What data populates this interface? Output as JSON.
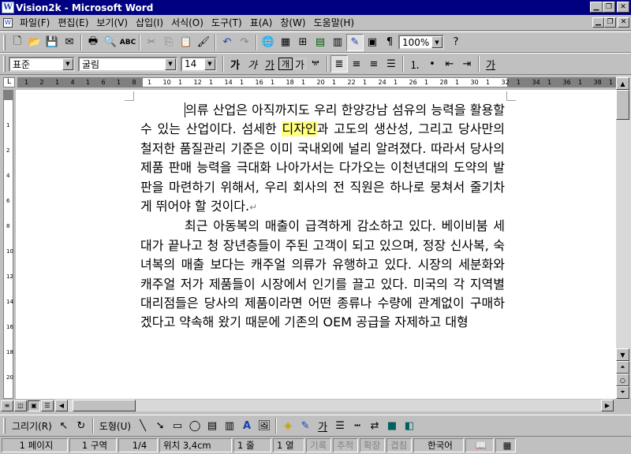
{
  "window": {
    "title": "Vision2k - Microsoft Word"
  },
  "menu": {
    "items": [
      "파일(F)",
      "편집(E)",
      "보기(V)",
      "삽입(I)",
      "서식(O)",
      "도구(T)",
      "표(A)",
      "창(W)",
      "도움말(H)"
    ]
  },
  "standard_toolbar": {
    "zoom": "100%"
  },
  "format_toolbar": {
    "style": "표준",
    "font": "굴림",
    "size": "14",
    "bold_glyph": "가",
    "italic_glyph": "가",
    "underline_glyph": "가",
    "border_glyph": "개",
    "shade_glyph": "가",
    "fontcolor_glyph": "가"
  },
  "ruler": {
    "labels": [
      "1",
      "2",
      "1",
      "4",
      "1",
      "6",
      "1",
      "8",
      "1",
      "10",
      "1",
      "12",
      "1",
      "14",
      "1",
      "16",
      "1",
      "18",
      "1",
      "20",
      "1",
      "22",
      "1",
      "24",
      "1",
      "26",
      "1",
      "28",
      "1",
      "30",
      "1",
      "32",
      "1",
      "34",
      "1",
      "36",
      "1",
      "38",
      "1",
      "40"
    ]
  },
  "document": {
    "p1_before": "의류 산업은 아직까지도 우리 한양강남 섬유의 능력을 활용할 수 있는 산업이다. 섬세한 ",
    "p1_highlight": "디자인",
    "p1_after": "과 고도의 생산성, 그리고 당사만의 철저한 품질관리 기준은 이미 국내외에 널리 알려졌다. 따라서 당사의 제품 판매 능력을 극대화  나아가서는 다가오는 이천년대의 도약의 발판을 마련하기 위해서, 우리 회사의 전 직원은 하나로 뭉쳐서 줄기차게 뛰어야 할 것이다.",
    "p1_mark": "↵",
    "p2": "최근 아동복의 매출이 급격하게 감소하고 있다. 베이비붐 세대가 끝나고 청 장년층들이 주된 고객이 되고 있으며,  정장 신사복, 숙녀복의 매출 보다는 캐주얼 의류가 유행하고 있다. 시장의 세분화와 캐주얼 저가 제품들이 시장에서 인기를 끌고 있다. 미국의 각 지역별 대리점들은 당사의 제품이라면 어떤 종류나 수량에 관계없이 구매하겠다고 약속해 왔기 때문에 기존의 OEM 공급을 자제하고 대형"
  },
  "drawing_toolbar": {
    "draw": "그리기(R)",
    "autoshape": "도형(U)"
  },
  "status": {
    "page": "1 페이지",
    "section": "1 구역",
    "pages": "1/4",
    "position": "위치 3,4cm",
    "line": "1 줄",
    "column": "1 열",
    "rec": "기록",
    "trk": "추적",
    "ext": "확장",
    "ovr": "겹침",
    "language": "한국어"
  }
}
